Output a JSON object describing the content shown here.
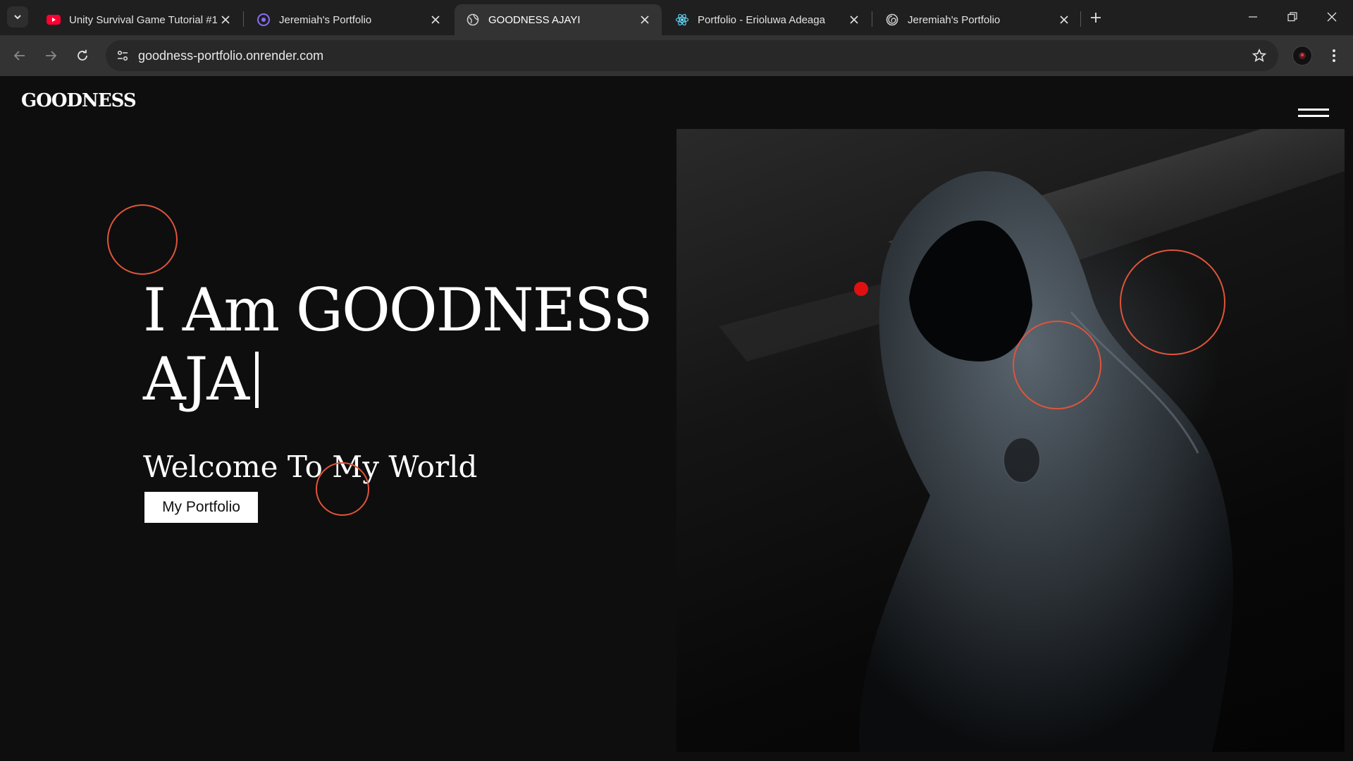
{
  "browser": {
    "tabs": [
      {
        "title": "Unity Survival Game Tutorial #1",
        "favicon": "youtube-icon",
        "active": false
      },
      {
        "title": "Jeremiah's Portfolio",
        "favicon": "jeremiah-site-icon",
        "active": false
      },
      {
        "title": "GOODNESS AJAYI",
        "favicon": "globe-icon",
        "active": true
      },
      {
        "title": "Portfolio - Erioluwa Adeaga",
        "favicon": "react-icon",
        "active": false
      },
      {
        "title": "Jeremiah's Portfolio",
        "favicon": "spiral-icon",
        "active": false
      }
    ],
    "url": "goodness-portfolio.onrender.com"
  },
  "site": {
    "logo": "GOODNESS",
    "hero": {
      "title_line1": "I Am GOODNESS",
      "title_line2": "AJA",
      "subtitle": "Welcome To My World",
      "button_label": "My Portfolio"
    }
  },
  "colors": {
    "accent_ring": "#e0543a",
    "dot": "#e01010",
    "background": "#0e0e0e",
    "button_bg": "#ffffff"
  }
}
